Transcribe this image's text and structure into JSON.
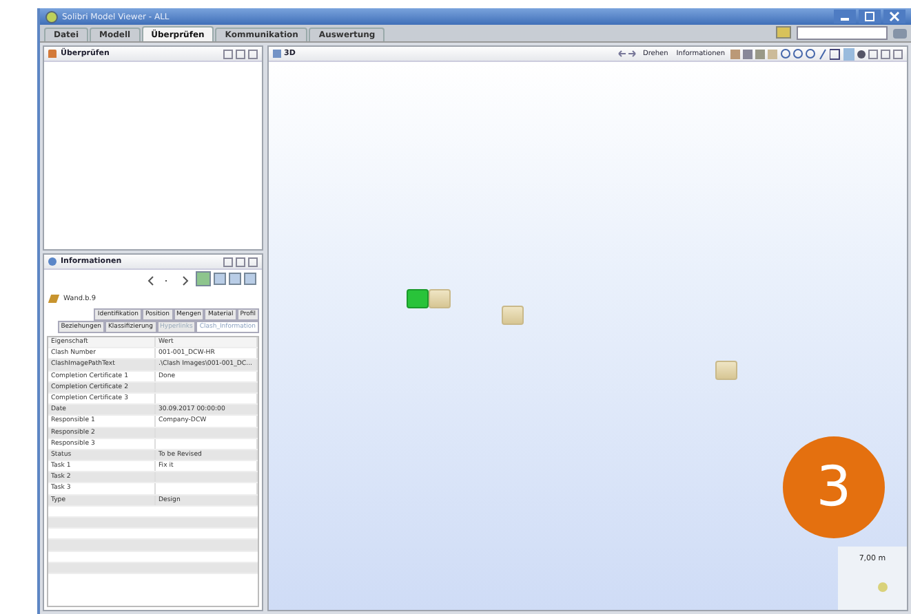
{
  "window": {
    "title": "Solibri Model Viewer - ALL"
  },
  "tabs": [
    {
      "label": "Datei",
      "selected": false
    },
    {
      "label": "Modell",
      "selected": false
    },
    {
      "label": "Überprüfen",
      "selected": true
    },
    {
      "label": "Kommunikation",
      "selected": false
    },
    {
      "label": "Auswertung",
      "selected": false
    }
  ],
  "check_panel": {
    "title": "Überprüfen"
  },
  "info_panel": {
    "title": "Informationen",
    "object": "Wand.b.9",
    "tab_rows": [
      [
        {
          "label": "Identifikation",
          "selected": false,
          "disabled": false
        },
        {
          "label": "Position",
          "selected": false,
          "disabled": false
        },
        {
          "label": "Mengen",
          "selected": false,
          "disabled": false
        },
        {
          "label": "Material",
          "selected": false,
          "disabled": false
        },
        {
          "label": "Profil",
          "selected": false,
          "disabled": false
        }
      ],
      [
        {
          "label": "Beziehungen",
          "selected": false,
          "disabled": false
        },
        {
          "label": "Klassifizierung",
          "selected": false,
          "disabled": false
        },
        {
          "label": "Hyperlinks",
          "selected": false,
          "disabled": true
        },
        {
          "label": "Clash_Information",
          "selected": true,
          "disabled": false
        }
      ]
    ],
    "columns": [
      "Eigenschaft",
      "Wert"
    ],
    "rows": [
      [
        "Clash Number",
        "001-001_DCW-HR"
      ],
      [
        "ClashImagePathText",
        ".\\Clash Images\\001-001_DC..."
      ],
      [
        "Completion Certificate 1",
        "Done"
      ],
      [
        "Completion Certificate 2",
        ""
      ],
      [
        "Completion Certificate 3",
        ""
      ],
      [
        "Date",
        "30.09.2017 00:00:00"
      ],
      [
        "Responsible 1",
        "Company-DCW"
      ],
      [
        "Responsible 2",
        ""
      ],
      [
        "Responsible 3",
        ""
      ],
      [
        "Status",
        "To be Revised"
      ],
      [
        "Task 1",
        "Fix it"
      ],
      [
        "Task 2",
        ""
      ],
      [
        "Task 3",
        ""
      ],
      [
        "Type",
        "Design"
      ]
    ]
  },
  "view3d": {
    "title": "3D",
    "toolbar": [
      {
        "kind": "dropdown",
        "label": "Drehen"
      },
      {
        "kind": "dropdown",
        "label": "Informationen"
      }
    ],
    "scale": "7,00 m",
    "objects": [
      {
        "highlighted": true
      },
      {
        "highlighted": false
      },
      {
        "highlighted": false
      },
      {
        "highlighted": false
      }
    ]
  },
  "badge": "3"
}
